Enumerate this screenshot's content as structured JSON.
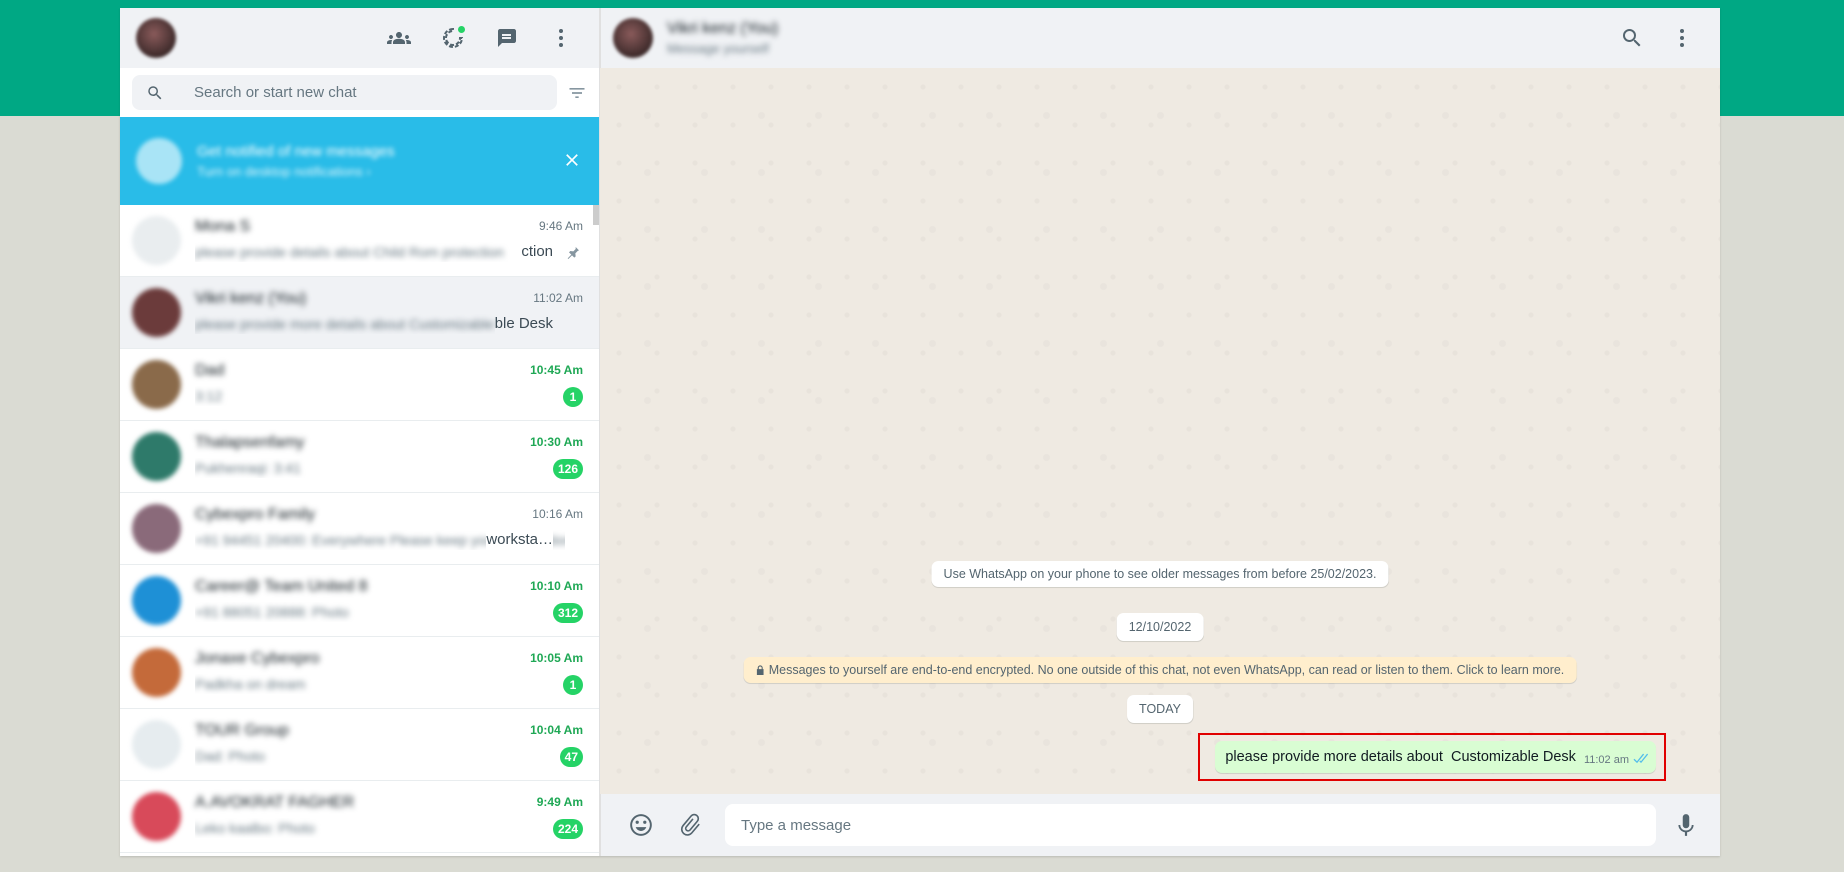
{
  "left_header": {
    "icons": [
      "community-icon",
      "status-icon",
      "new-chat-icon",
      "menu-icon"
    ]
  },
  "search": {
    "placeholder": "Search or start new chat"
  },
  "notification_banner": {
    "title": "Get notified of new messages",
    "subtitle": "Turn on desktop notifications ›"
  },
  "chats": [
    {
      "name": "Mona S",
      "preview": "please provide details about Child Rom protection",
      "preview_tail": "ction",
      "time": "9:46 Am",
      "unread": "",
      "pinned": true,
      "color": "#e9edef",
      "active": false
    },
    {
      "name": "Vikri kenz (You)",
      "preview": "please provide more details about Customizable Desk",
      "preview_tail": "ble Desk",
      "time": "11:02 Am",
      "unread": "",
      "pinned": false,
      "color": "#6b3b3b",
      "active": true
    },
    {
      "name": "Dad",
      "preview": "3:12",
      "preview_tail": "",
      "time": "10:45 Am",
      "unread": "1",
      "pinned": false,
      "color": "#8a6a4a",
      "active": false
    },
    {
      "name": "Thalapsenfamy",
      "preview": "Pukhenraqi: 3:41",
      "preview_tail": "",
      "time": "10:30 Am",
      "unread": "126",
      "pinned": false,
      "color": "#2e7a6a",
      "active": false
    },
    {
      "name": "Cybexpro Family",
      "preview": "+91 94451 20400: Everywhere Please keep your workstation",
      "preview_tail": "worksta…",
      "time": "10:16 Am",
      "unread": "",
      "pinned": false,
      "color": "#8a6a7a",
      "active": false
    },
    {
      "name": "Career@ Team United 8",
      "preview": "+91 88051 20888: Photo",
      "preview_tail": "",
      "time": "10:10 Am",
      "unread": "312",
      "pinned": false,
      "color": "#1e90d6",
      "active": false
    },
    {
      "name": "Jonaxe Cybexpro",
      "preview": "Padkha on dream",
      "preview_tail": "",
      "time": "10:05 Am",
      "unread": "1",
      "pinned": false,
      "color": "#c46a3a",
      "active": false
    },
    {
      "name": "TOUR Group",
      "preview": "Dad: Photo",
      "preview_tail": "",
      "time": "10:04 Am",
      "unread": "47",
      "pinned": false,
      "color": "#e6ecef",
      "active": false
    },
    {
      "name": "A.AVOKRAT FAGHER",
      "preview": "Leko kaalbo: Photo",
      "preview_tail": "",
      "time": "9:49 Am",
      "unread": "224",
      "pinned": false,
      "color": "#d84a5a",
      "active": false
    }
  ],
  "conversation": {
    "contact_name": "Vikri kenz (You)",
    "contact_sub": "Message yourself",
    "older_notice": "Use WhatsApp on your phone to see older messages from before 25/02/2023.",
    "date_old": "12/10/2022",
    "encryption_notice": "Messages to yourself are end-to-end encrypted. No one outside of this chat, not even WhatsApp, can read or listen to them. Click to learn more.",
    "date_today": "TODAY",
    "out_message": "please provide more details about  Customizable Desk",
    "out_time": "11:02 am"
  },
  "composer": {
    "placeholder": "Type a message"
  },
  "colors": {
    "brand": "#00a884",
    "unread": "#25d366",
    "banner": "#29bce8",
    "out_bubble": "#d9fdd3",
    "highlight": "#e00000"
  }
}
